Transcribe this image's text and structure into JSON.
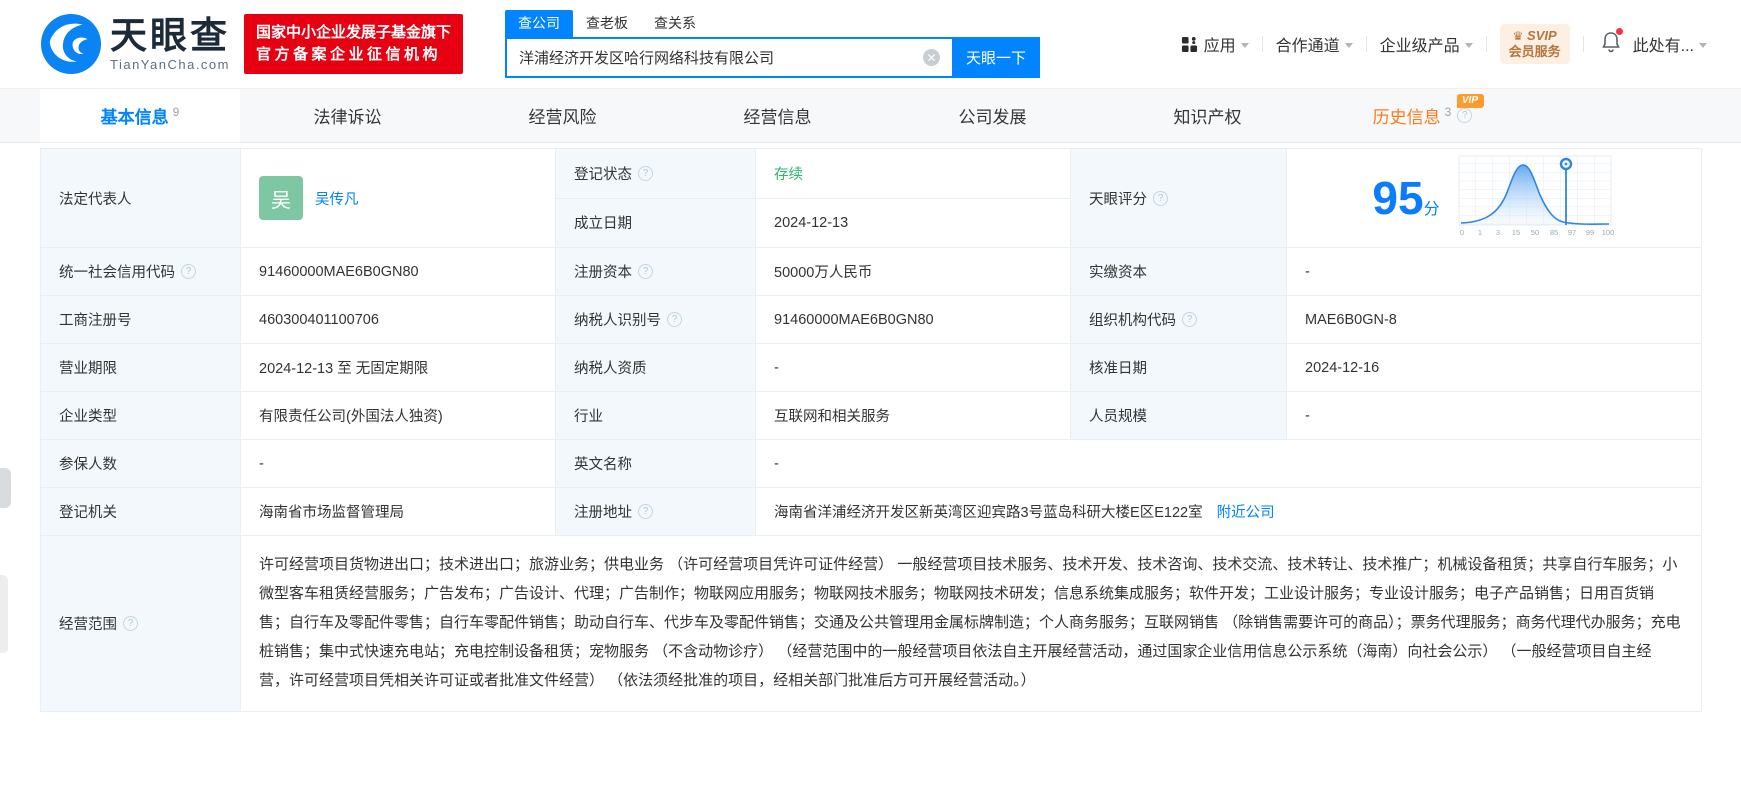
{
  "colors": {
    "accent": "#0084ff",
    "badge_red": "#e60012",
    "status_green": "#2ab76a",
    "history_orange": "#ff7a1e",
    "label_cell_bg": "#f2f8fb",
    "avatar_green": "#7dc8a3"
  },
  "header": {
    "brand": "天眼查",
    "brand_domain": "TianYanCha.com",
    "badge_line1": "国家中小企业发展子基金旗下",
    "badge_line2": "官方备案企业征信机构",
    "search": {
      "tabs": [
        {
          "label": "查公司",
          "active": true
        },
        {
          "label": "查老板",
          "active": false
        },
        {
          "label": "查关系",
          "active": false
        }
      ],
      "value": "洋浦经济开发区哈行网络科技有限公司",
      "button": "天眼一下"
    },
    "nav": {
      "apps": "应用",
      "coop": "合作通道",
      "enterprise": "企业级产品",
      "svip_top": "SVIP",
      "svip_bottom": "会员服务",
      "more": "此处有..."
    }
  },
  "tabs": {
    "basic": {
      "label": "基本信息",
      "count": "9"
    },
    "legal": {
      "label": "法律诉讼"
    },
    "risk": {
      "label": "经营风险"
    },
    "operation": {
      "label": "经营信息"
    },
    "development": {
      "label": "公司发展"
    },
    "ip": {
      "label": "知识产权"
    },
    "history": {
      "label": "历史信息",
      "count": "3",
      "vip": "VIP"
    }
  },
  "profile": {
    "legal_rep": {
      "label": "法定代表人",
      "avatar": "吴",
      "name": "吴传凡"
    },
    "reg_status": {
      "label": "登记状态",
      "value": "存续"
    },
    "est_date": {
      "label": "成立日期",
      "value": "2024-12-13"
    },
    "score": {
      "label": "天眼评分",
      "value": "95",
      "unit": "分",
      "ticks": [
        "0",
        "1",
        "3",
        "15",
        "50",
        "85",
        "97",
        "99",
        "100"
      ]
    },
    "rows": [
      [
        {
          "label": "统一社会信用代码",
          "value": "91460000MAE6B0GN80"
        },
        {
          "label": "注册资本",
          "value": "50000万人民币"
        },
        {
          "label": "实缴资本",
          "value": "-"
        }
      ],
      [
        {
          "label": "工商注册号",
          "value": "460300401100706"
        },
        {
          "label": "纳税人识别号",
          "value": "91460000MAE6B0GN80"
        },
        {
          "label": "组织机构代码",
          "value": "MAE6B0GN-8"
        }
      ],
      [
        {
          "label": "营业期限",
          "value": "2024-12-13 至 无固定期限"
        },
        {
          "label": "纳税人资质",
          "value": "-"
        },
        {
          "label": "核准日期",
          "value": "2024-12-16"
        }
      ],
      [
        {
          "label": "企业类型",
          "value": "有限责任公司(外国法人独资)"
        },
        {
          "label": "行业",
          "value": "互联网和相关服务"
        },
        {
          "label": "人员规模",
          "value": "-"
        }
      ],
      [
        {
          "label": "参保人数",
          "value": "-"
        },
        {
          "label": "英文名称",
          "value": "-"
        }
      ]
    ],
    "reg_authority": {
      "label": "登记机关",
      "value": "海南省市场监督管理局"
    },
    "reg_address": {
      "label": "注册地址",
      "value": "海南省洋浦经济开发区新英湾区迎宾路3号蓝岛科研大楼E区E122室",
      "link": "附近公司"
    },
    "scope": {
      "label": "经营范围",
      "value": "许可经营项目货物进出口；技术进出口；旅游业务；供电业务 （许可经营项目凭许可证件经营） 一般经营项目技术服务、技术开发、技术咨询、技术交流、技术转让、技术推广；机械设备租赁；共享自行车服务；小微型客车租赁经营服务；广告发布；广告设计、代理；广告制作；物联网应用服务；物联网技术服务；物联网技术研发；信息系统集成服务；软件开发；工业设计服务；专业设计服务；电子产品销售；日用百货销售；自行车及零配件零售；自行车零配件销售；助动自行车、代步车及零配件销售；交通及公共管理用金属标牌制造；个人商务服务；互联网销售 （除销售需要许可的商品）；票务代理服务；商务代理代办服务；充电桩销售；集中式快速充电站；充电控制设备租赁；宠物服务 （不含动物诊疗） （经营范围中的一般经营项目依法自主开展经营活动，通过国家企业信用信息公示系统（海南）向社会公示） （一般经营项目自主经营，许可经营项目凭相关许可证或者批准文件经营） （依法须经批准的项目，经相关部门批准后方可开展经营活动。）"
    }
  },
  "chart_data": {
    "type": "area",
    "title": "天眼评分分布曲线",
    "score": 95,
    "x_ticks": [
      0,
      1,
      3,
      15,
      50,
      85,
      97,
      99,
      100
    ],
    "marker_x": 95,
    "curve_shape": "normal distribution bell curve, peak near middle tick 50, marker pin dropped near tick 97",
    "grid": true,
    "legend_position": "none"
  }
}
